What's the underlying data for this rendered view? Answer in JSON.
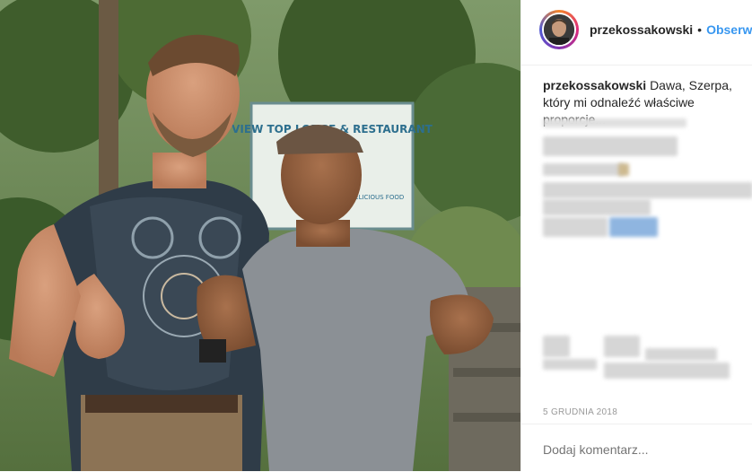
{
  "post": {
    "username": "przekossakowski",
    "separator": "•",
    "follow_label": "Obserwuj",
    "caption_username": "przekossakowski",
    "caption_text": "Dawa, Szerpa, który mi odnaleźć właściwe proporcje...",
    "date": "5 grudnia 2018",
    "comment_placeholder": "Dodaj komentarz..."
  },
  "photo": {
    "sign_text_line1": "VIEW TOP LODGE & RESTAURANT",
    "sign_text_line2": "DELICIOUS FOOD"
  },
  "colors": {
    "link": "#3897f0",
    "text": "#262626",
    "muted": "#999999"
  }
}
